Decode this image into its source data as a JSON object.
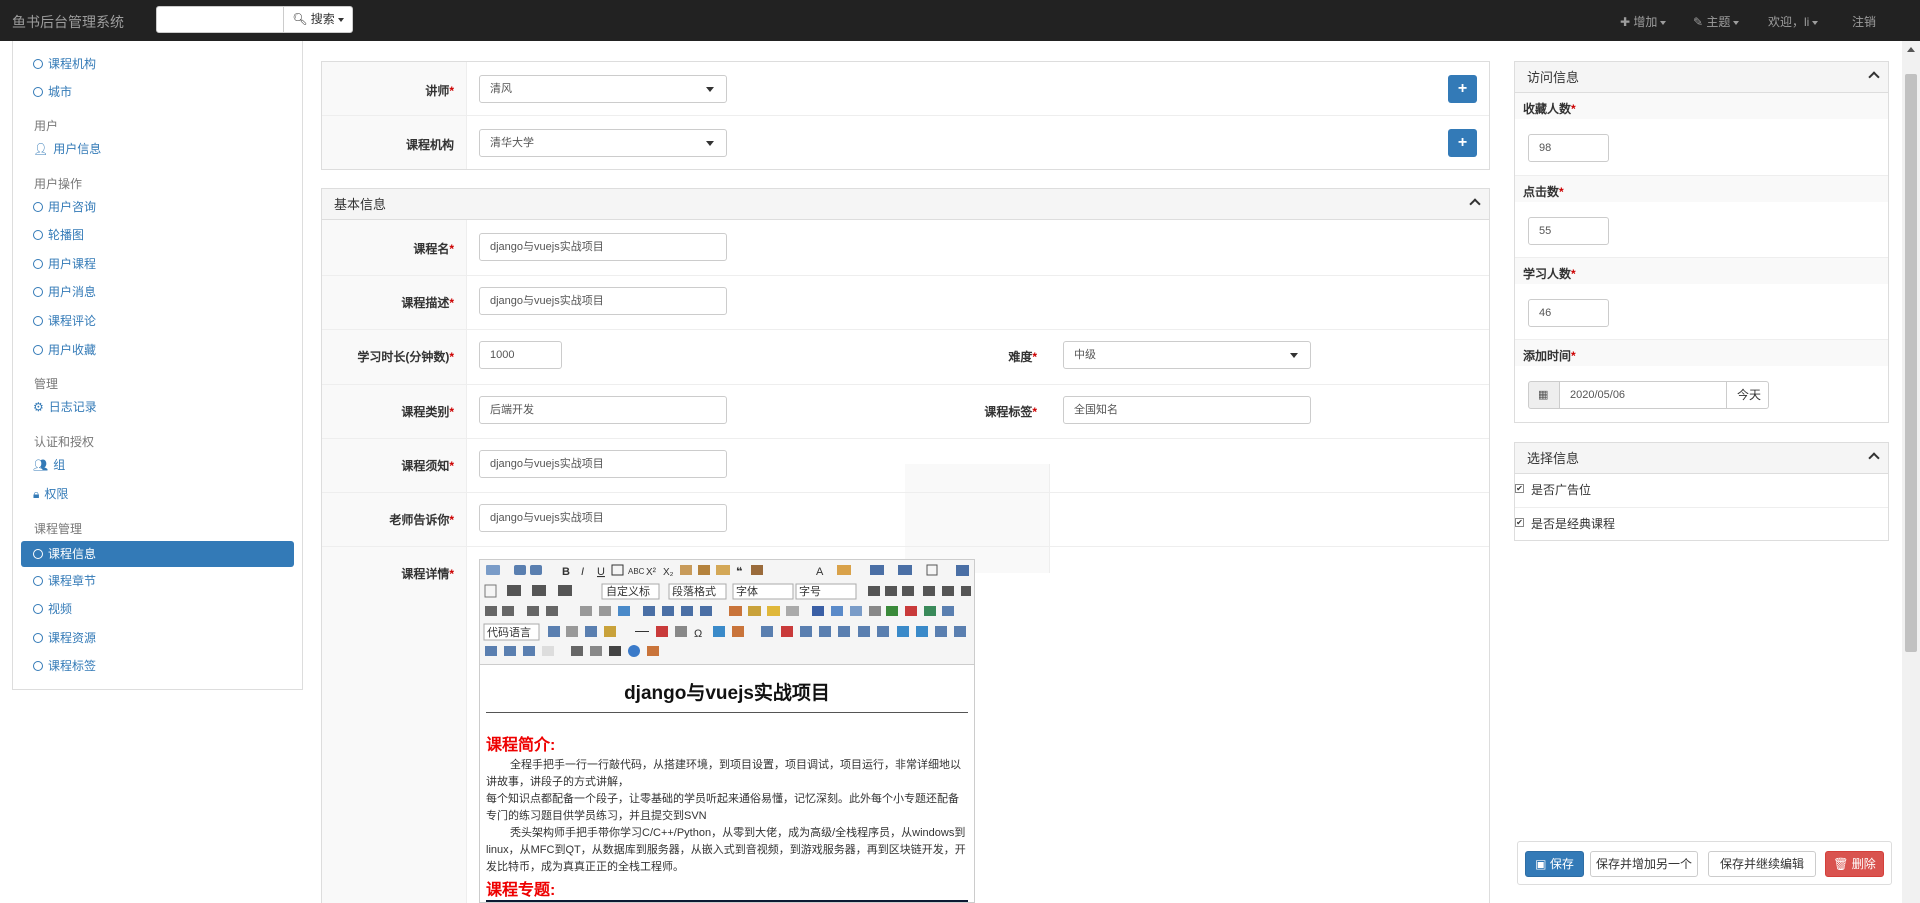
{
  "navbar": {
    "brand": "鱼书后台管理系统",
    "search_label": "搜索",
    "add_label": "增加",
    "theme_label": "主题",
    "welcome": "欢迎，li",
    "logout": "注销"
  },
  "sidebar": {
    "items_top": [
      "课程机构",
      "城市"
    ],
    "groups": [
      {
        "title": "用户",
        "items": [
          "用户信息"
        ]
      },
      {
        "title": "用户操作",
        "items": [
          "用户咨询",
          "轮播图",
          "用户课程",
          "用户消息",
          "课程评论",
          "用户收藏"
        ]
      },
      {
        "title": "管理",
        "items": [
          "日志记录"
        ]
      },
      {
        "title": "认证和授权",
        "items": [
          "组",
          "权限"
        ]
      },
      {
        "title": "课程管理",
        "items": [
          "课程信息",
          "课程章节",
          "视频",
          "课程资源",
          "课程标签"
        ]
      }
    ]
  },
  "top_panel": {
    "teacher_label": "讲师",
    "teacher_value": "清风",
    "org_label": "课程机构",
    "org_value": "清华大学"
  },
  "basic": {
    "title": "基本信息",
    "name_label": "课程名",
    "name_value": "django与vuejs实战项目",
    "desc_label": "课程描述",
    "desc_value": "django与vuejs实战项目",
    "duration_label": "学习时长(分钟数)",
    "duration_value": "1000",
    "difficulty_label": "难度",
    "difficulty_value": "中级",
    "category_label": "课程类别",
    "category_value": "后端开发",
    "tag_label": "课程标签",
    "tag_value": "全国知名",
    "notice_label": "课程须知",
    "notice_value": "django与vuejs实战项目",
    "tell_label": "老师告诉你",
    "tell_value": "django与vuejs实战项目",
    "detail_label": "课程详情"
  },
  "editor": {
    "font_custom": "自定义标",
    "para_format": "段落格式",
    "font_family": "字体",
    "font_size": "字号",
    "code_lang": "代码语言",
    "heading": "django与vuejs实战项目",
    "intro_title": "课程简介:",
    "intro_p1": "全程手把手一行一行敲代码，从搭建环境，到项目设置，项目调试，项目运行，非常详细地以讲故事，讲段子的方式讲解，",
    "intro_p2": "每个知识点都配备一个段子，让零基础的学员听起来通俗易懂，记忆深刻。此外每个小专题还配备专门的练习题目供学员练习，并且提交到SVN",
    "intro_p3": "秃头架构师手把手带你学习C/C++/Python，从零到大佬，成为高级/全栈程序员，从windows到linux，从MFC到QT，从数据库到服务器，从嵌入式到音视频，到游戏服务器，再到区块链开发，开发比特币，成为真真正正的全栈工程师。",
    "topic_title": "课程专题:"
  },
  "visit": {
    "title": "访问信息",
    "fav_label": "收藏人数",
    "fav_value": "98",
    "click_label": "点击数",
    "click_value": "55",
    "students_label": "学习人数",
    "students_value": "46",
    "add_time_label": "添加时间",
    "add_time_value": "2020/05/06",
    "today": "今天"
  },
  "choice": {
    "title": "选择信息",
    "ad_label": "是否广告位",
    "classic_label": "是否是经典课程"
  },
  "actions": {
    "save": "保存",
    "save_add": "保存并增加另一个",
    "save_continue": "保存并继续编辑",
    "delete": "删除"
  }
}
